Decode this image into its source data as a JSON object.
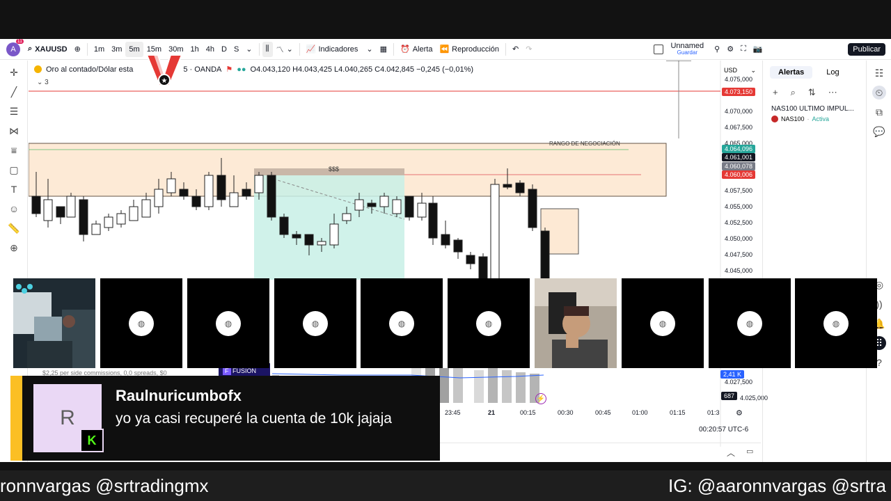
{
  "toolbar": {
    "avatar_letter": "A",
    "avatar_badge": "11",
    "symbol": "XAUUSD",
    "intervals": [
      "1m",
      "3m",
      "5m",
      "15m",
      "30m",
      "1h",
      "4h",
      "D",
      "S"
    ],
    "active_interval": "5m",
    "indicators": "Indicadores",
    "alert": "Alerta",
    "replay": "Reproducción",
    "layout_name": "Unnamed",
    "layout_sub": "Guardar",
    "publish": "Publicar"
  },
  "chart": {
    "legend_title": "Oro al contado/Dólar esta",
    "legend_interval": "5 · OANDA",
    "ohlc": "O4.043,120  H4.043,425  L4.040,265  C4.042,845  −0,245 (−0,01%)",
    "indicator_count": "3",
    "currency": "USD",
    "zone_label": "RANGO DE NEGOCIACIÓN",
    "target_label": "$$$",
    "y_ticks": [
      "4.075,000",
      "4.070,000",
      "4.067,500",
      "4.065,000",
      "4.057,500",
      "4.055,000",
      "4.052,500",
      "4.050,000",
      "4.047,500",
      "4.045,000",
      "4.027,500",
      "4.025,000"
    ],
    "price_tags": [
      {
        "value": "4.073,150",
        "color": "#e53935"
      },
      {
        "value": "4.064,096",
        "color": "#26a69a"
      },
      {
        "value": "4.061,001",
        "color": "#131722"
      },
      {
        "value": "4.060,078",
        "color": "#787b86"
      },
      {
        "value": "4.060,006",
        "color": "#e53935"
      }
    ],
    "volume_tags": [
      "2,41 K",
      "687"
    ],
    "time_ticks": [
      "23:45",
      "21",
      "00:15",
      "00:30",
      "00:45",
      "01:00",
      "01:15",
      "01:3"
    ],
    "clock": "00:20:57 UTC-6",
    "fusion_label": "FUSION",
    "commission_text": "$2,25 per side commissions, 0,0 spreads, $0"
  },
  "alerts_panel": {
    "tabs": [
      "Alertas",
      "Log"
    ],
    "item_title": "NAS100 ULTIMO IMPUL...",
    "item_symbol": "NAS100",
    "item_status": "Activa"
  },
  "chat": {
    "avatar_letter": "R",
    "username": "Raulnuricumbofx",
    "message": "yo ya casi recuperé la cuenta de 10k jajaja"
  },
  "ticker": {
    "left_text": "ronnvargas @srtradingmx",
    "right_text": "IG: @aaronnvargas @srtra"
  }
}
